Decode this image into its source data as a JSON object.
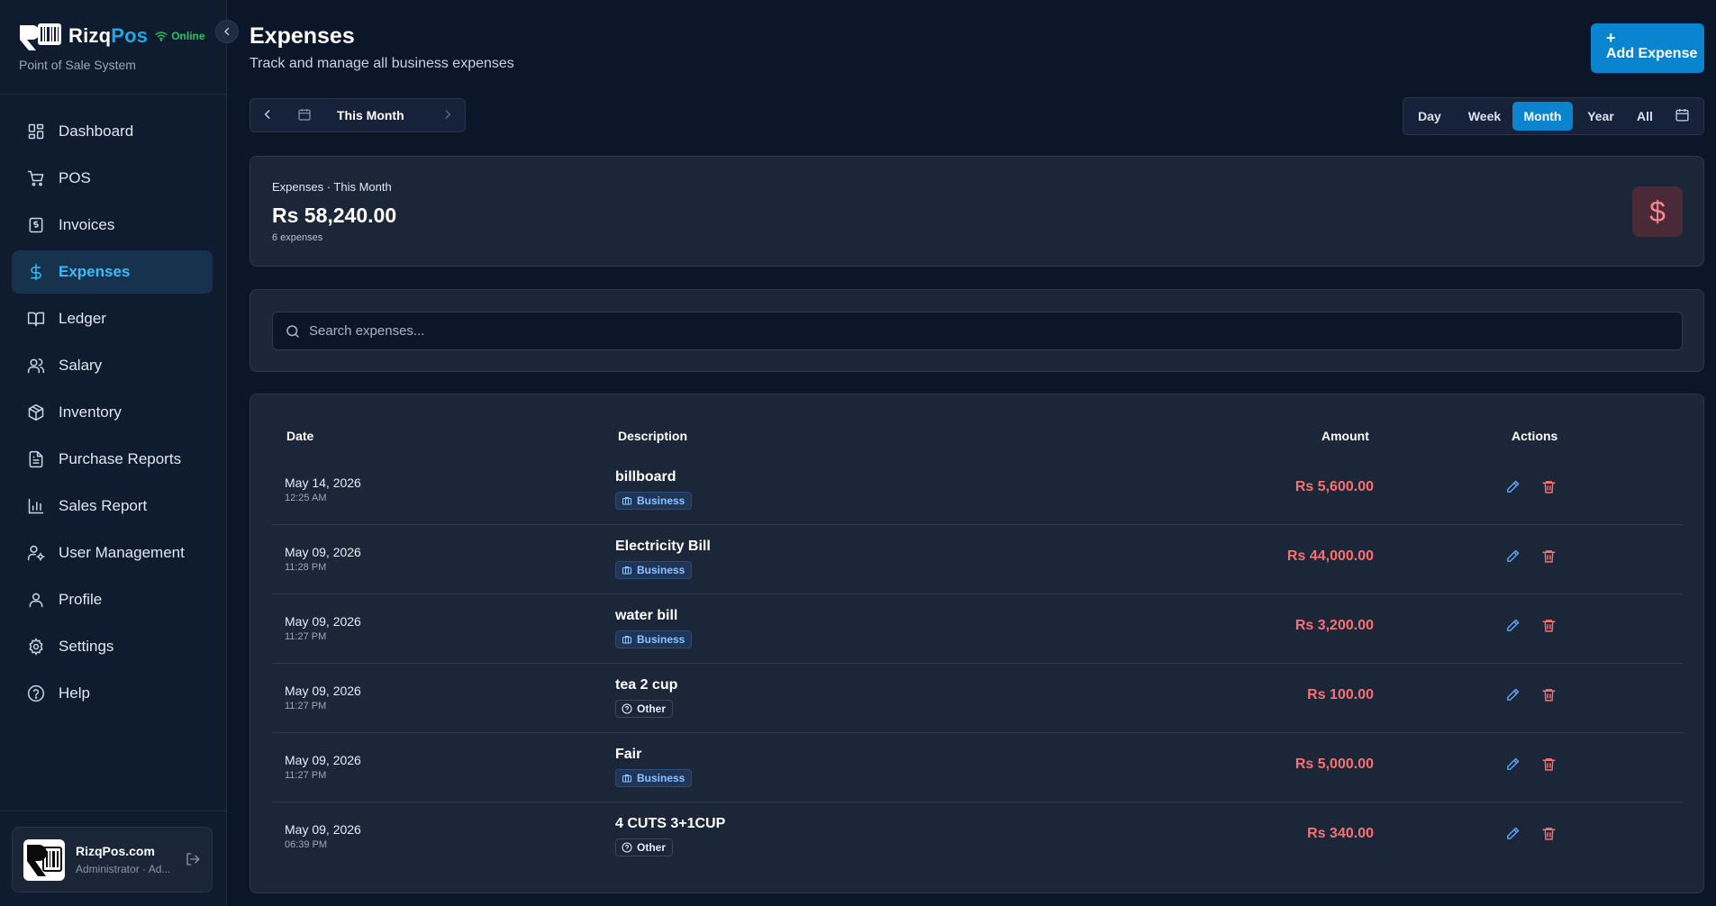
{
  "brand": {
    "name_a": "Rizq",
    "name_b": "Pos",
    "status": "Online",
    "subtitle": "Point of Sale System"
  },
  "sidebar": {
    "items": [
      {
        "label": "Dashboard",
        "icon": "dashboard-icon"
      },
      {
        "label": "POS",
        "icon": "cart-icon"
      },
      {
        "label": "Invoices",
        "icon": "invoice-icon"
      },
      {
        "label": "Expenses",
        "icon": "dollar-icon",
        "active": true
      },
      {
        "label": "Ledger",
        "icon": "book-icon"
      },
      {
        "label": "Salary",
        "icon": "users-icon"
      },
      {
        "label": "Inventory",
        "icon": "box-icon"
      },
      {
        "label": "Purchase Reports",
        "icon": "file-icon"
      },
      {
        "label": "Sales Report",
        "icon": "bar-chart-icon"
      },
      {
        "label": "User Management",
        "icon": "user-cog-icon"
      },
      {
        "label": "Profile",
        "icon": "user-icon"
      },
      {
        "label": "Settings",
        "icon": "gear-icon"
      },
      {
        "label": "Help",
        "icon": "help-icon"
      }
    ]
  },
  "user": {
    "name": "RizqPos.com",
    "role": "Administrator · Ad..."
  },
  "header": {
    "title": "Expenses",
    "subtitle": "Track and manage all business expenses",
    "add_label": "Add Expense",
    "add_plus": "+"
  },
  "period": {
    "label": "This Month"
  },
  "range_tabs": [
    "Day",
    "Week",
    "Month",
    "Year",
    "All"
  ],
  "range_active": "Month",
  "summary": {
    "label": "Expenses · This Month",
    "value": "Rs 58,240.00",
    "count": "6 expenses",
    "icon_glyph": "$"
  },
  "search": {
    "placeholder": "Search expenses..."
  },
  "table": {
    "headers": {
      "date": "Date",
      "description": "Description",
      "amount": "Amount",
      "actions": "Actions"
    },
    "rows": [
      {
        "date": "May 14, 2026",
        "time": "12:25 AM",
        "description": "billboard",
        "category": "Business",
        "amount": "Rs 5,600.00"
      },
      {
        "date": "May 09, 2026",
        "time": "11:28 PM",
        "description": "Electricity Bill",
        "category": "Business",
        "amount": "Rs 44,000.00"
      },
      {
        "date": "May 09, 2026",
        "time": "11:27 PM",
        "description": "water bill",
        "category": "Business",
        "amount": "Rs 3,200.00"
      },
      {
        "date": "May 09, 2026",
        "time": "11:27 PM",
        "description": "tea 2 cup",
        "category": "Other",
        "amount": "Rs 100.00"
      },
      {
        "date": "May 09, 2026",
        "time": "11:27 PM",
        "description": "Fair",
        "category": "Business",
        "amount": "Rs 5,000.00"
      },
      {
        "date": "May 09, 2026",
        "time": "06:39 PM",
        "description": "4 CUTS 3+1CUP",
        "category": "Other",
        "amount": "Rs 340.00"
      }
    ]
  },
  "colors": {
    "accent": "#0a84cf",
    "expense_red": "#f87171",
    "bg": "#0c1629",
    "card": "#1b2639"
  }
}
